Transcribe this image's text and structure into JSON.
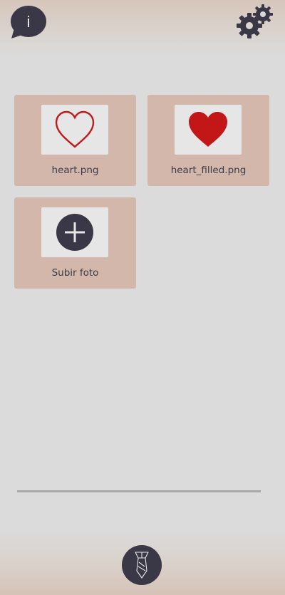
{
  "header": {
    "info_icon": "info-speech-bubble-icon",
    "settings_icon": "gears-icon"
  },
  "gallery": {
    "items": [
      {
        "label": "heart.png",
        "icon": "heart-outline-icon",
        "color": "#c21a1a"
      },
      {
        "label": "heart_filled.png",
        "icon": "heart-filled-icon",
        "color": "#c31616"
      },
      {
        "label": "Subir foto",
        "icon": "plus-circle-icon",
        "color": "#3a3746"
      }
    ]
  },
  "footer": {
    "main_icon": "tie-icon"
  },
  "colors": {
    "tile_bg": "#d3b7aa",
    "thumb_bg": "#e6e6e6",
    "dark": "#3a3746",
    "page_bg": "#dbdbdb"
  }
}
